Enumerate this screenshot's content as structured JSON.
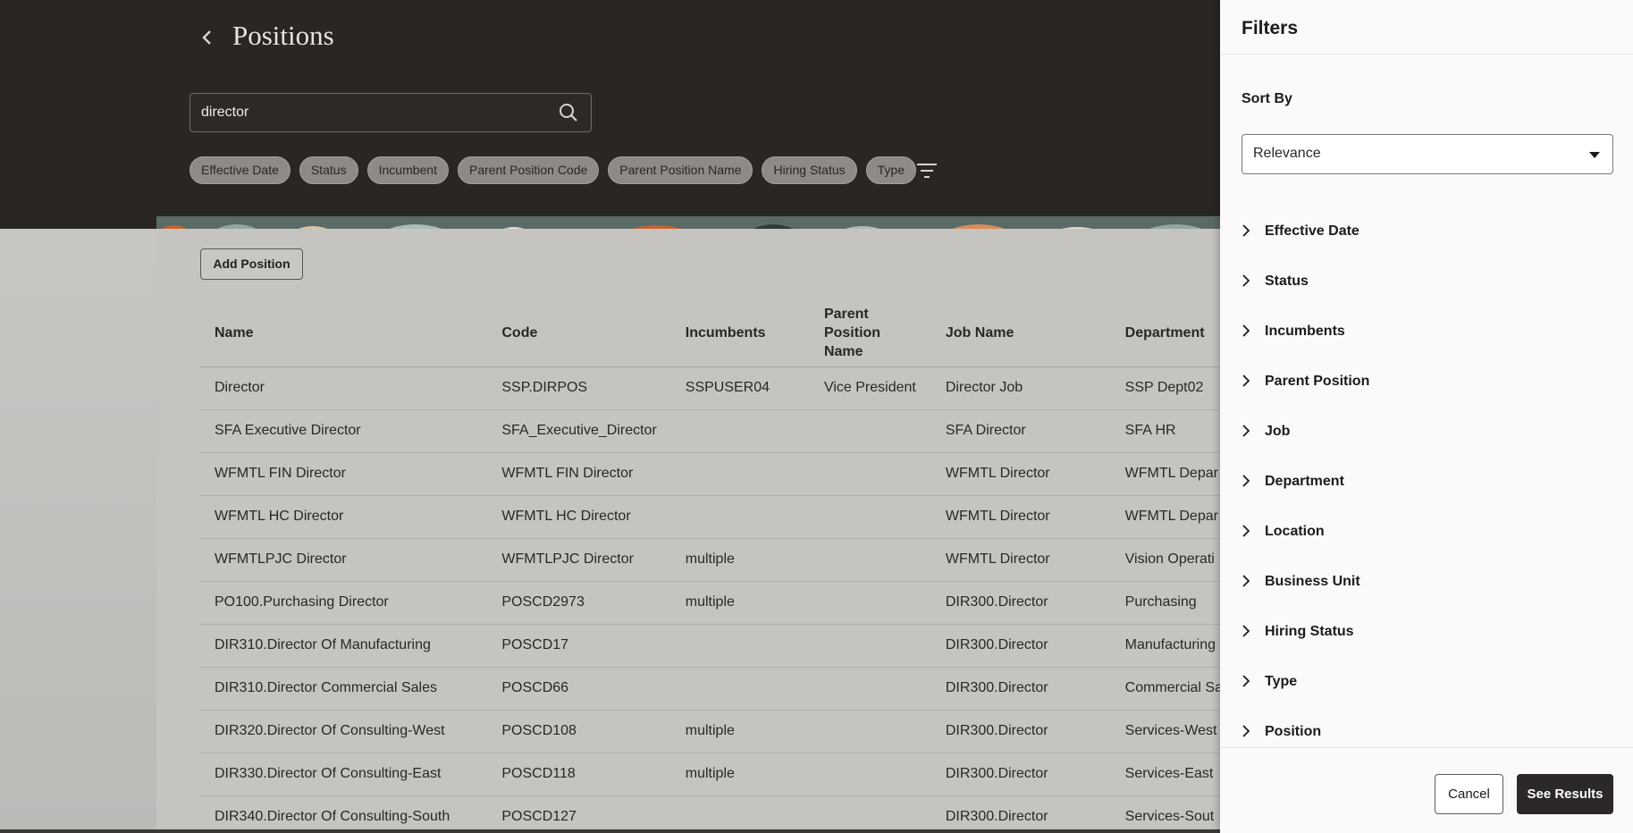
{
  "header": {
    "title": "Positions",
    "search_value": "director",
    "chips": [
      "Effective Date",
      "Status",
      "Incumbent",
      "Parent Position Code",
      "Parent Position Name",
      "Hiring Status",
      "Type"
    ]
  },
  "main": {
    "add_label": "Add Position",
    "columns": [
      "Name",
      "Code",
      "Incumbents",
      "Parent Position Name",
      "Job Name",
      "Department"
    ],
    "rows": [
      [
        "Director",
        "SSP.DIRPOS",
        "SSPUSER04",
        "Vice President",
        "Director Job",
        "SSP Dept02"
      ],
      [
        "SFA Executive Director",
        "SFA_Executive_Director",
        "",
        "",
        "SFA Director",
        "SFA HR"
      ],
      [
        "WFMTL FIN Director",
        "WFMTL FIN Director",
        "",
        "",
        "WFMTL Director",
        "WFMTL Depar"
      ],
      [
        "WFMTL HC Director",
        "WFMTL HC Director",
        "",
        "",
        "WFMTL Director",
        "WFMTL Depar"
      ],
      [
        "WFMTLPJC Director",
        "WFMTLPJC Director",
        "multiple",
        "",
        "WFMTL Director",
        "Vision Operati"
      ],
      [
        "PO100.Purchasing Director",
        "POSCD2973",
        "multiple",
        "",
        "DIR300.Director",
        "Purchasing"
      ],
      [
        "DIR310.Director Of Manufacturing",
        "POSCD17",
        "",
        "",
        "DIR300.Director",
        "Manufacturing"
      ],
      [
        "DIR310.Director Commercial Sales",
        "POSCD66",
        "",
        "",
        "DIR300.Director",
        "Commercial Sa"
      ],
      [
        "DIR320.Director Of Consulting-West",
        "POSCD108",
        "multiple",
        "",
        "DIR300.Director",
        "Services-West"
      ],
      [
        "DIR330.Director Of Consulting-East",
        "POSCD118",
        "multiple",
        "",
        "DIR300.Director",
        "Services-East"
      ],
      [
        "DIR340.Director Of Consulting-South",
        "POSCD127",
        "",
        "",
        "DIR300.Director",
        "Services-Sout"
      ]
    ]
  },
  "panel": {
    "title": "Filters",
    "sort_label": "Sort By",
    "sort_value": "Relevance",
    "facets": [
      "Effective Date",
      "Status",
      "Incumbents",
      "Parent Position",
      "Job",
      "Department",
      "Location",
      "Business Unit",
      "Hiring Status",
      "Type",
      "Position"
    ],
    "cancel_label": "Cancel",
    "see_results_label": "See Results"
  },
  "colors": {
    "header_bg": "#292624",
    "primary_button": "#2b2827",
    "overlay": "#c6c4c1"
  }
}
